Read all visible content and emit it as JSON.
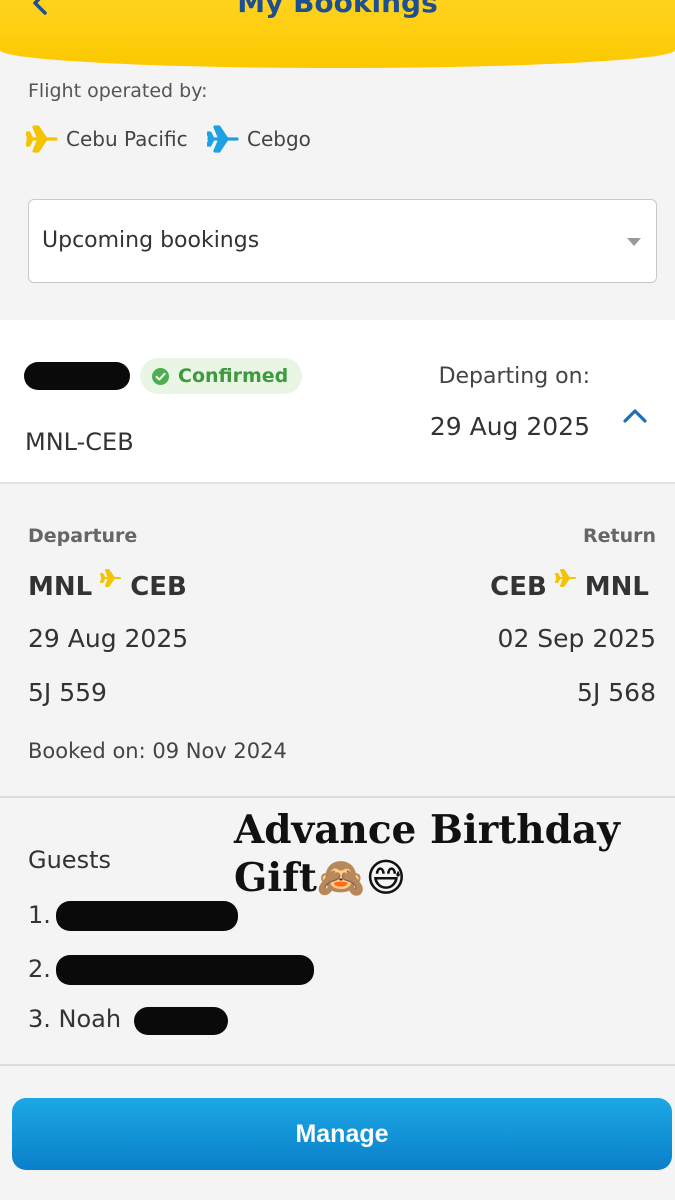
{
  "header": {
    "title": "My Bookings"
  },
  "operated_by": {
    "label": "Flight operated by:",
    "airlines": [
      {
        "name": "Cebu Pacific",
        "icon": "plane-icon",
        "color": "#f5c400"
      },
      {
        "name": "Cebgo",
        "icon": "plane-icon",
        "color": "#1da1e2"
      }
    ]
  },
  "filter": {
    "selected": "Upcoming bookings"
  },
  "booking": {
    "status": "Confirmed",
    "route": "MNL-CEB",
    "departing_label": "Departing on:",
    "departing_date": "29 Aug 2025"
  },
  "details": {
    "departure": {
      "label": "Departure",
      "from": "MNL",
      "to": "CEB",
      "date": "29 Aug 2025",
      "flight": "5J 559"
    },
    "return": {
      "label": "Return",
      "from": "CEB",
      "to": "MNL",
      "date": "02 Sep 2025",
      "flight": "5J 568"
    },
    "booked_on": "Booked on: 09 Nov 2024"
  },
  "guests": {
    "title": "Guests",
    "list": [
      "1.",
      "2.",
      "3. Noah"
    ]
  },
  "overlay": {
    "line1": "Advance Birthday",
    "line2": "Gift",
    "emoji": "🙈😅"
  },
  "actions": {
    "manage": "Manage"
  },
  "colors": {
    "brand_yellow": "#fcc900",
    "brand_blue": "#1d4f91",
    "button_blue": "#0a7fca",
    "confirmed_green": "#3e9a3c"
  }
}
